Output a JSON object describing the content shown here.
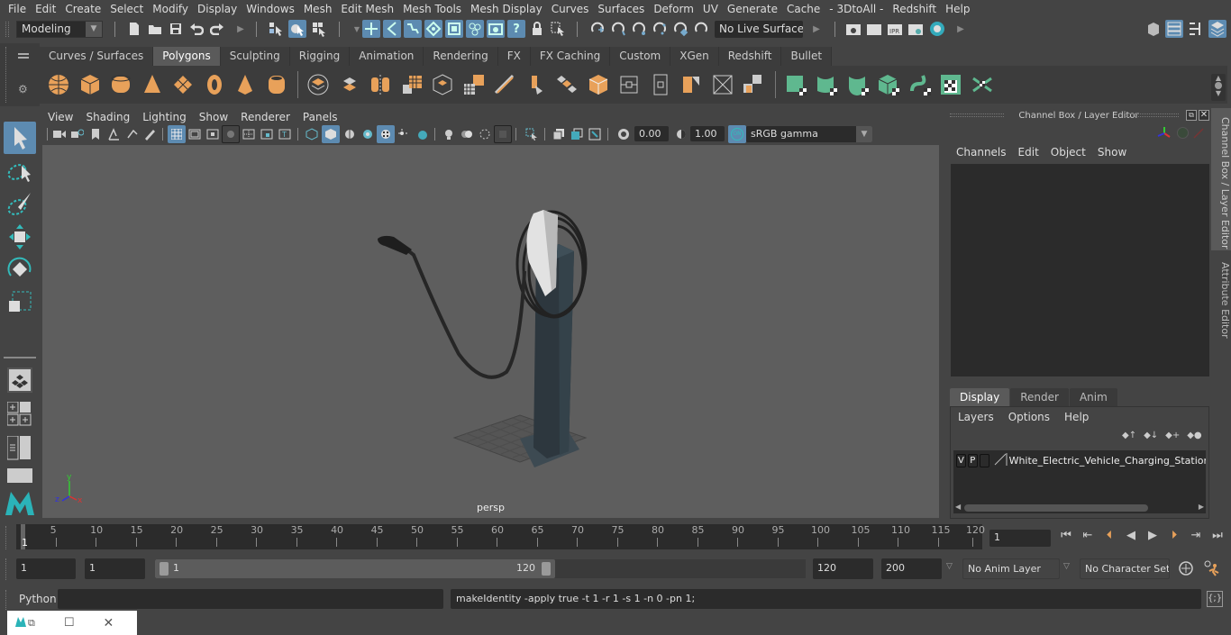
{
  "menubar": {
    "items": [
      "File",
      "Edit",
      "Create",
      "Select",
      "Modify",
      "Display",
      "Windows",
      "Mesh",
      "Edit Mesh",
      "Mesh Tools",
      "Mesh Display",
      "Curves",
      "Surfaces",
      "Deform",
      "UV",
      "Generate",
      "Cache",
      "- 3DtoAll -",
      "Redshift",
      "Help"
    ]
  },
  "statusline": {
    "mode": "Modeling",
    "live_surface": "No Live Surface"
  },
  "shelf": {
    "tabs": [
      "Curves / Surfaces",
      "Polygons",
      "Sculpting",
      "Rigging",
      "Animation",
      "Rendering",
      "FX",
      "FX Caching",
      "Custom",
      "XGen",
      "Redshift",
      "Bullet"
    ],
    "active_tab": "Polygons",
    "accent_orange": "#e8a15a",
    "accent_green": "#5fb88f"
  },
  "viewport": {
    "menu": [
      "View",
      "Shading",
      "Lighting",
      "Show",
      "Renderer",
      "Panels"
    ],
    "exposure": "0.00",
    "gamma": "1.00",
    "color_mgmt_badge": "ON",
    "colorspace": "sRGB gamma",
    "camera_label": "persp",
    "axis": {
      "x": "x",
      "y": "y",
      "z": "z"
    }
  },
  "channelbox": {
    "title": "Channel Box / Layer Editor",
    "menu": [
      "Channels",
      "Edit",
      "Object",
      "Show"
    ],
    "layer_tabs": [
      "Display",
      "Render",
      "Anim"
    ],
    "active_layer_tab": "Display",
    "layer_menu": [
      "Layers",
      "Options",
      "Help"
    ],
    "layers": [
      {
        "v": "V",
        "p": "P",
        "name": "White_Electric_Vehicle_Charging_Station_o"
      }
    ]
  },
  "sidetabs": [
    "Channel Box / Layer Editor",
    "Attribute Editor"
  ],
  "timeline": {
    "ticks": [
      5,
      10,
      15,
      20,
      25,
      30,
      35,
      40,
      45,
      50,
      55,
      60,
      65,
      70,
      75,
      80,
      85,
      90,
      95,
      100,
      105,
      110,
      115,
      120
    ],
    "current_frame_marker": "1",
    "current_frame": "1",
    "start": 1,
    "end": 120
  },
  "range": {
    "start_time": "1",
    "playback_start": "1",
    "slider_start": "1",
    "slider_end": "120",
    "playback_end": "120",
    "end_time": "200",
    "anim_layer": "No Anim Layer",
    "character_set": "No Character Set"
  },
  "commandline": {
    "language": "Python",
    "input": "",
    "result": "makeIdentity -apply true -t 1 -r 1 -s 1 -n 0 -pn 1;"
  }
}
